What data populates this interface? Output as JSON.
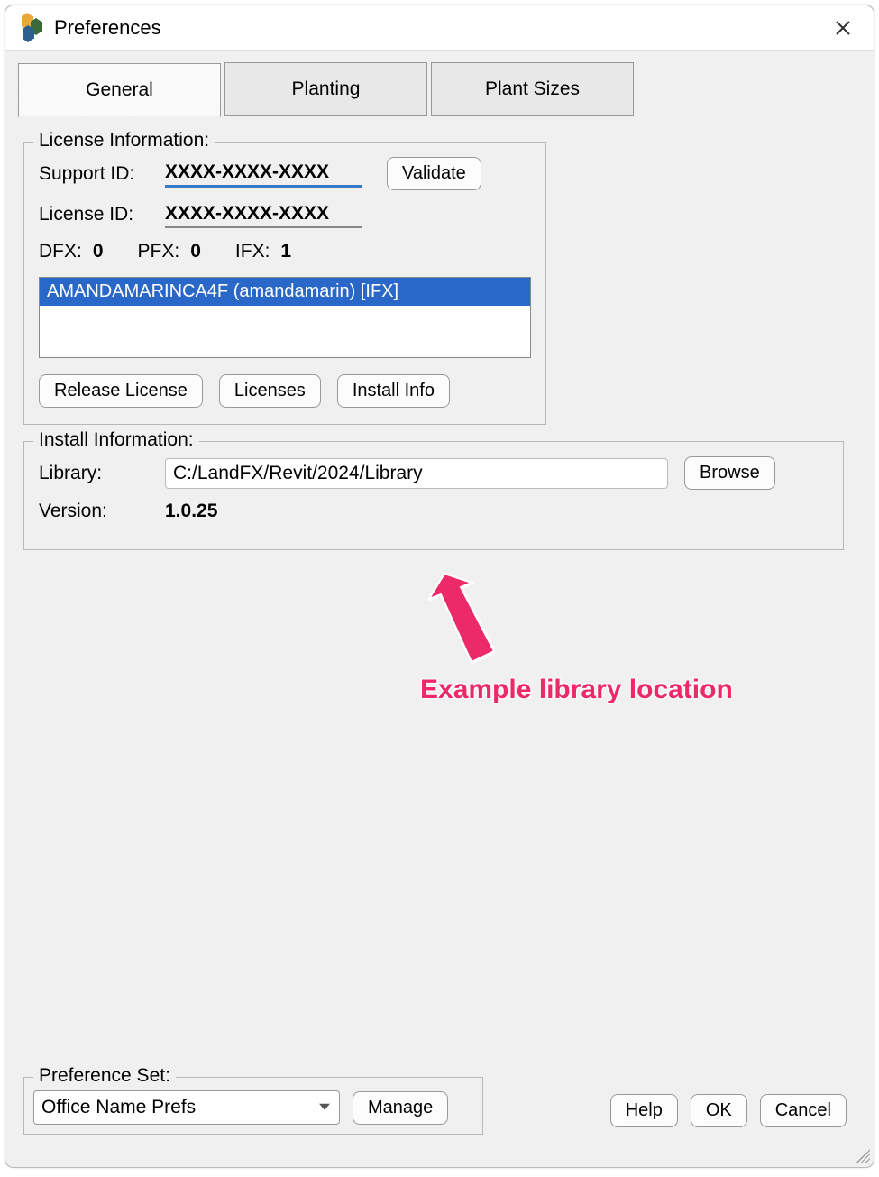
{
  "window": {
    "title": "Preferences"
  },
  "tabs": [
    {
      "label": "General"
    },
    {
      "label": "Planting"
    },
    {
      "label": "Plant Sizes"
    }
  ],
  "license": {
    "legend": "License Information:",
    "supportIdLabel": "Support ID:",
    "supportId": "XXXX-XXXX-XXXX",
    "licenseIdLabel": "License ID:",
    "licenseId": "XXXX-XXXX-XXXX",
    "validate": "Validate",
    "dfxLabel": "DFX:",
    "dfx": "0",
    "pfxLabel": "PFX:",
    "pfx": "0",
    "ifxLabel": "IFX:",
    "ifx": "1",
    "listItem": "AMANDAMARINCA4F (amandamarin) [IFX]",
    "release": "Release License",
    "licensesBtn": "Licenses",
    "installInfoBtn": "Install Info"
  },
  "install": {
    "legend": "Install Information:",
    "libraryLabel": "Library:",
    "libraryPath": "C:/LandFX/Revit/2024/Library",
    "browse": "Browse",
    "versionLabel": "Version:",
    "version": "1.0.25"
  },
  "annotation": {
    "text": "Example library location"
  },
  "prefSet": {
    "legend": "Preference Set:",
    "selected": "Office Name Prefs",
    "manage": "Manage"
  },
  "footer": {
    "help": "Help",
    "ok": "OK",
    "cancel": "Cancel"
  }
}
